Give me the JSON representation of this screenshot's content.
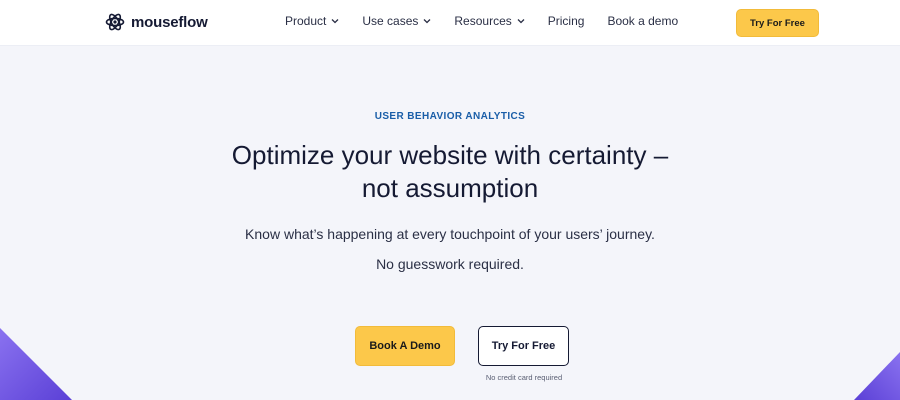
{
  "header": {
    "logo_text": "mouseflow",
    "logo_icon": "atom-icon",
    "nav": [
      {
        "label": "Product",
        "has_dropdown": true
      },
      {
        "label": "Use cases",
        "has_dropdown": true
      },
      {
        "label": "Resources",
        "has_dropdown": true
      },
      {
        "label": "Pricing",
        "has_dropdown": false
      },
      {
        "label": "Book a demo",
        "has_dropdown": false
      }
    ],
    "cta_label": "Try For Free"
  },
  "hero": {
    "eyebrow": "USER BEHAVIOR ANALYTICS",
    "headline_line1": "Optimize your website with certainty –",
    "headline_line2": "not assumption",
    "subtext_line1": "Know what’s happening at every touchpoint of your users’ journey.",
    "subtext_line2": "No guesswork required.",
    "primary_button": "Book A Demo",
    "secondary_button": "Try For Free",
    "note": "No credit card required"
  },
  "colors": {
    "accent_yellow": "#fcc84a",
    "eyebrow_blue": "#1a5ea8",
    "text_dark": "#151a33",
    "background": "#f4f5fa",
    "decor_purple": "#6b52e0"
  }
}
